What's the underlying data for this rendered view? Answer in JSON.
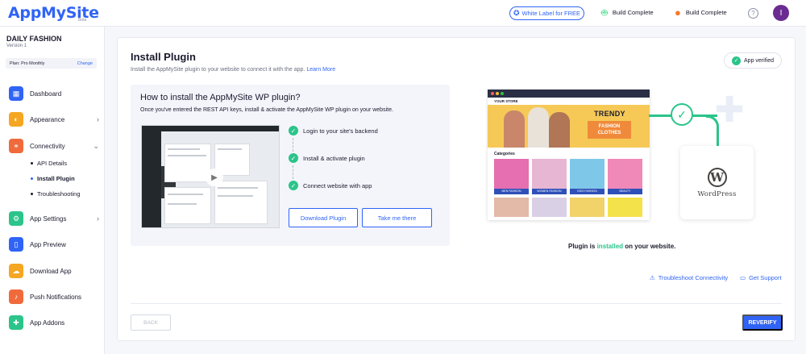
{
  "header": {
    "logo": "AppMySite",
    "logo_badge": "Beta",
    "white_label": "White Label for FREE",
    "android_status": "Build Complete",
    "ios_status": "Build Complete",
    "avatar_initial": "I"
  },
  "sidebar": {
    "app_name": "DAILY FASHION",
    "version": "Version 1",
    "plan": "Plan: Pro Monthly",
    "plan_change": "Change",
    "items": [
      {
        "label": "Dashboard",
        "icon": "dashboard-icon",
        "color": "#3064f6"
      },
      {
        "label": "Appearance",
        "icon": "palette-icon",
        "color": "#f5a623"
      },
      {
        "label": "Connectivity",
        "icon": "connectivity-icon",
        "color": "#f06a3c"
      },
      {
        "label": "App Settings",
        "icon": "gear-icon",
        "color": "#2bc48a"
      },
      {
        "label": "App Preview",
        "icon": "phone-icon",
        "color": "#3064f6"
      },
      {
        "label": "Download App",
        "icon": "cloud-download-icon",
        "color": "#f5a623"
      },
      {
        "label": "Push Notifications",
        "icon": "bell-icon",
        "color": "#f06a3c"
      },
      {
        "label": "App Addons",
        "icon": "puzzle-icon",
        "color": "#2bc48a"
      }
    ],
    "sub_items": [
      "API Details",
      "Install Plugin",
      "Troubleshooting"
    ],
    "active_sub_item": "Install Plugin"
  },
  "main": {
    "title": "Install Plugin",
    "subtitle": "Install the AppMySite plugin to your website to connect it with the app.",
    "learn_more": "Learn More",
    "verified_badge": "App verified",
    "how_title": "How to install the AppMySite WP plugin?",
    "how_desc": "Once you've entered the REST API keys, install & activate the AppMySite WP plugin on your website.",
    "steps": [
      "Login to your site's backend",
      "Install & activate plugin",
      "Connect website with app"
    ],
    "download_button": "Download Plugin",
    "take_me_button": "Take me there",
    "preview": {
      "brand": "YOUR STORE",
      "hero_title": "TRENDY",
      "hero_box_line1": "FASHION",
      "hero_box_line2": "CLOTHES",
      "categories_title": "Categories",
      "categories": [
        "MEN FASHION",
        "WOMEN FASHION",
        "KIDS FASHION",
        "BEAUTY"
      ]
    },
    "wordpress_label": "WordPress",
    "status_pre": "Plugin is",
    "status_word": "installed",
    "status_post": "on your website.",
    "troubleshoot_link": "Troubleshoot Connectivity",
    "support_link": "Get Support",
    "back_button": "BACK",
    "reverify_button": "REVERIFY"
  }
}
